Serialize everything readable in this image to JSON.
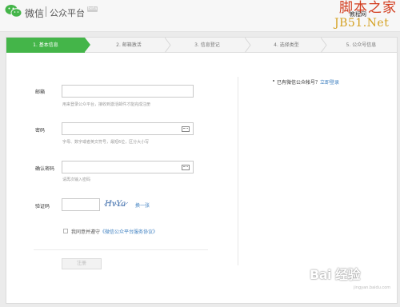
{
  "header": {
    "logo_text": "微信",
    "platform_text": "公众平台",
    "beta_badge": "beta"
  },
  "watermark": {
    "top": "脚本之家",
    "sub": "教程网",
    "url": "JB51.Net",
    "baidu": "Bai  经验",
    "baidu_sub": "jingyan.baidu.com"
  },
  "steps": [
    {
      "label": "1. 基本信息",
      "active": true
    },
    {
      "label": "2. 邮箱激活",
      "active": false
    },
    {
      "label": "3. 信息登记",
      "active": false
    },
    {
      "label": "4. 选择类型",
      "active": false
    },
    {
      "label": "5. 公众号信息",
      "active": false
    }
  ],
  "form": {
    "email_label": "邮箱",
    "email_value": "",
    "email_hint": "用来登录公众平台，接收到激活邮件才能完成注册",
    "password_label": "密码",
    "password_value": "",
    "password_hint": "字母、数字或者英文符号，最短6位，区分大小写",
    "confirm_label": "确认密码",
    "confirm_value": "",
    "confirm_hint": "请再次输入密码",
    "captcha_label": "验证码",
    "captcha_value": "",
    "captcha_text": "HvYa",
    "refresh_link": "换一张",
    "agree_text": "我同意并遵守",
    "agree_link": "《微信公众平台服务协议》",
    "register_button": "注册"
  },
  "side": {
    "question": "已有微信公众帐号？",
    "login_link": "立即登录"
  },
  "colors": {
    "accent": "#44b549",
    "link": "#3d7fc0"
  }
}
